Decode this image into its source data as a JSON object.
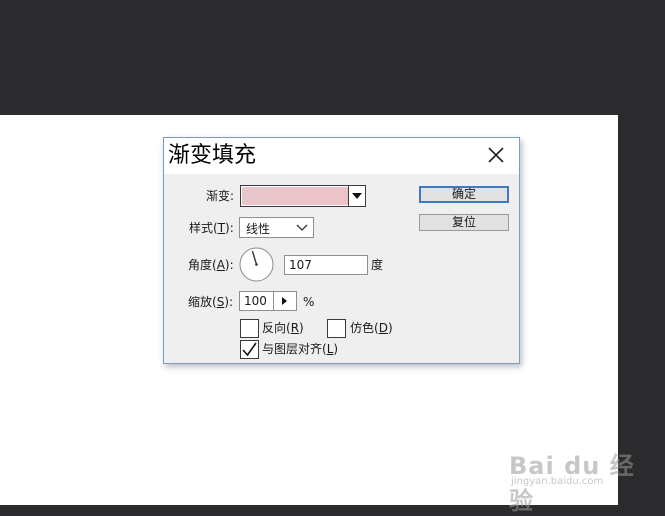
{
  "dialog": {
    "title": "渐变填充",
    "gradient": {
      "label": "渐变:",
      "swatch_start": "#e8c6cb",
      "swatch_end": "#ebc3c8"
    },
    "style": {
      "label_prefix": "样式(",
      "label_key": "T",
      "label_suffix": "):",
      "value": "线性"
    },
    "angle": {
      "label_prefix": "角度(",
      "label_key": "A",
      "label_suffix": "):",
      "value": "107",
      "unit": "度"
    },
    "scale": {
      "label_prefix": "缩放(",
      "label_key": "S",
      "label_suffix": "):",
      "value": "100",
      "unit": "%"
    },
    "reverse": {
      "label_prefix": "反向(",
      "label_key": "R",
      "label_suffix": ")",
      "checked": false
    },
    "dither": {
      "label_prefix": "仿色(",
      "label_key": "D",
      "label_suffix": ")",
      "checked": false
    },
    "align": {
      "label_prefix": "与图层对齐(",
      "label_key": "L",
      "label_suffix": ")",
      "checked": true
    },
    "ok_label": "确定",
    "reset_label": "复位"
  },
  "watermark": {
    "brand": "Bai du 经验",
    "url": "jingyan.baidu.com"
  },
  "colors": {
    "accent": "#3e7bc4",
    "dialog_border": "#7a9cc0",
    "background": "#2b2b2d"
  }
}
